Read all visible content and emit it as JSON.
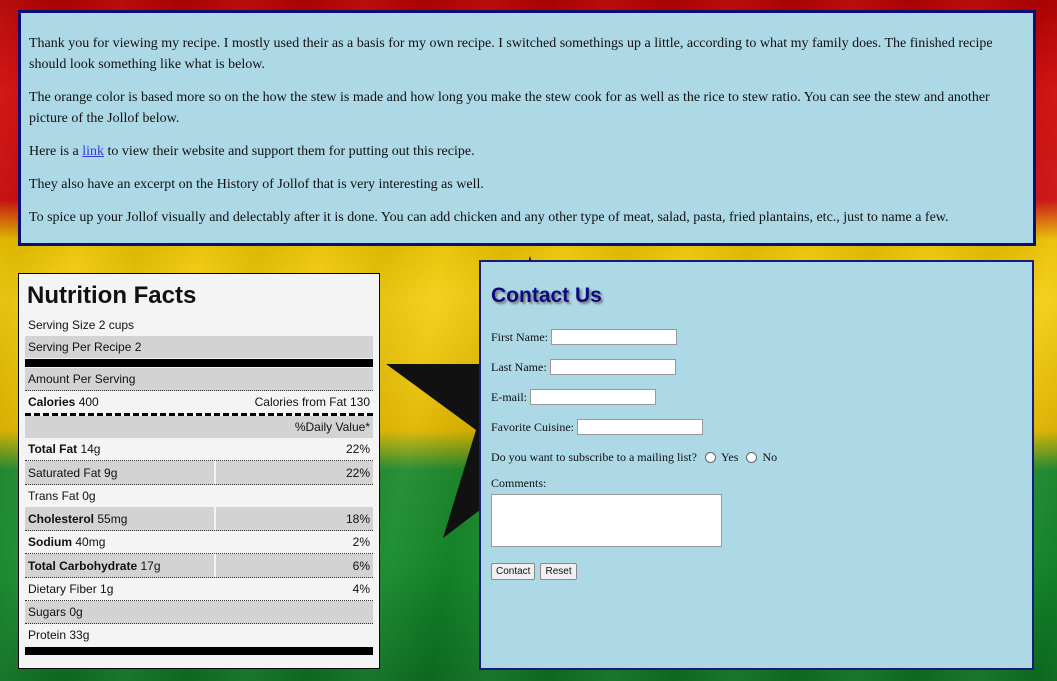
{
  "intro": {
    "p1": "Thank you for viewing my recipe. I mostly used their as a basis for my own recipe. I switched somethings up a little, according to what my family does. The finished recipe should look something like what is below.",
    "p2": "The orange color is based more so on the how the stew is made and how long you make the stew cook for as well as the rice to stew ratio. You can see the stew and another picture of the Jollof below.",
    "p3_before": "Here is a ",
    "p3_link": "link",
    "p3_after": " to view their website and support them for putting out this recipe.",
    "p4": "They also have an excerpt on the History of Jollof that is very interesting as well.",
    "p5": "To spice up your Jollof visually and delectably after it is done. You can add chicken and any other type of meat, salad, pasta, fried plantains, etc., just to name a few."
  },
  "nutrition": {
    "title": "Nutrition Facts",
    "serving_size": "Serving Size 2 cups",
    "servings": "Serving Per Recipe 2",
    "amount_per_serving": "Amount Per Serving",
    "calories_label": "Calories",
    "calories_value": "400",
    "calories_fat": "Calories from Fat 130",
    "daily_value": "%Daily Value*",
    "total_fat_label": "Total Fat",
    "total_fat_value": "14g",
    "total_fat_pct": "22%",
    "sat_fat": "Saturated Fat 9g",
    "sat_fat_pct": "22%",
    "trans_fat": "Trans Fat 0g",
    "chol_label": "Cholesterol",
    "chol_value": "55mg",
    "chol_pct": "18%",
    "sodium_label": "Sodium",
    "sodium_value": "40mg",
    "sodium_pct": "2%",
    "carb_label": "Total Carbohydrate",
    "carb_value": "17g",
    "carb_pct": "6%",
    "fiber": "Dietary Fiber 1g",
    "fiber_pct": "4%",
    "sugars": "Sugars 0g",
    "protein": "Protein 33g"
  },
  "contact": {
    "title": "Contact Us",
    "first_name": "First Name:",
    "last_name": "Last Name:",
    "email": "E-mail:",
    "cuisine": "Favorite Cuisine:",
    "subscribe": "Do you want to subscribe to a mailing list?",
    "yes": "Yes",
    "no": "No",
    "comments": "Comments:",
    "submit": "Contact",
    "reset": "Reset"
  }
}
